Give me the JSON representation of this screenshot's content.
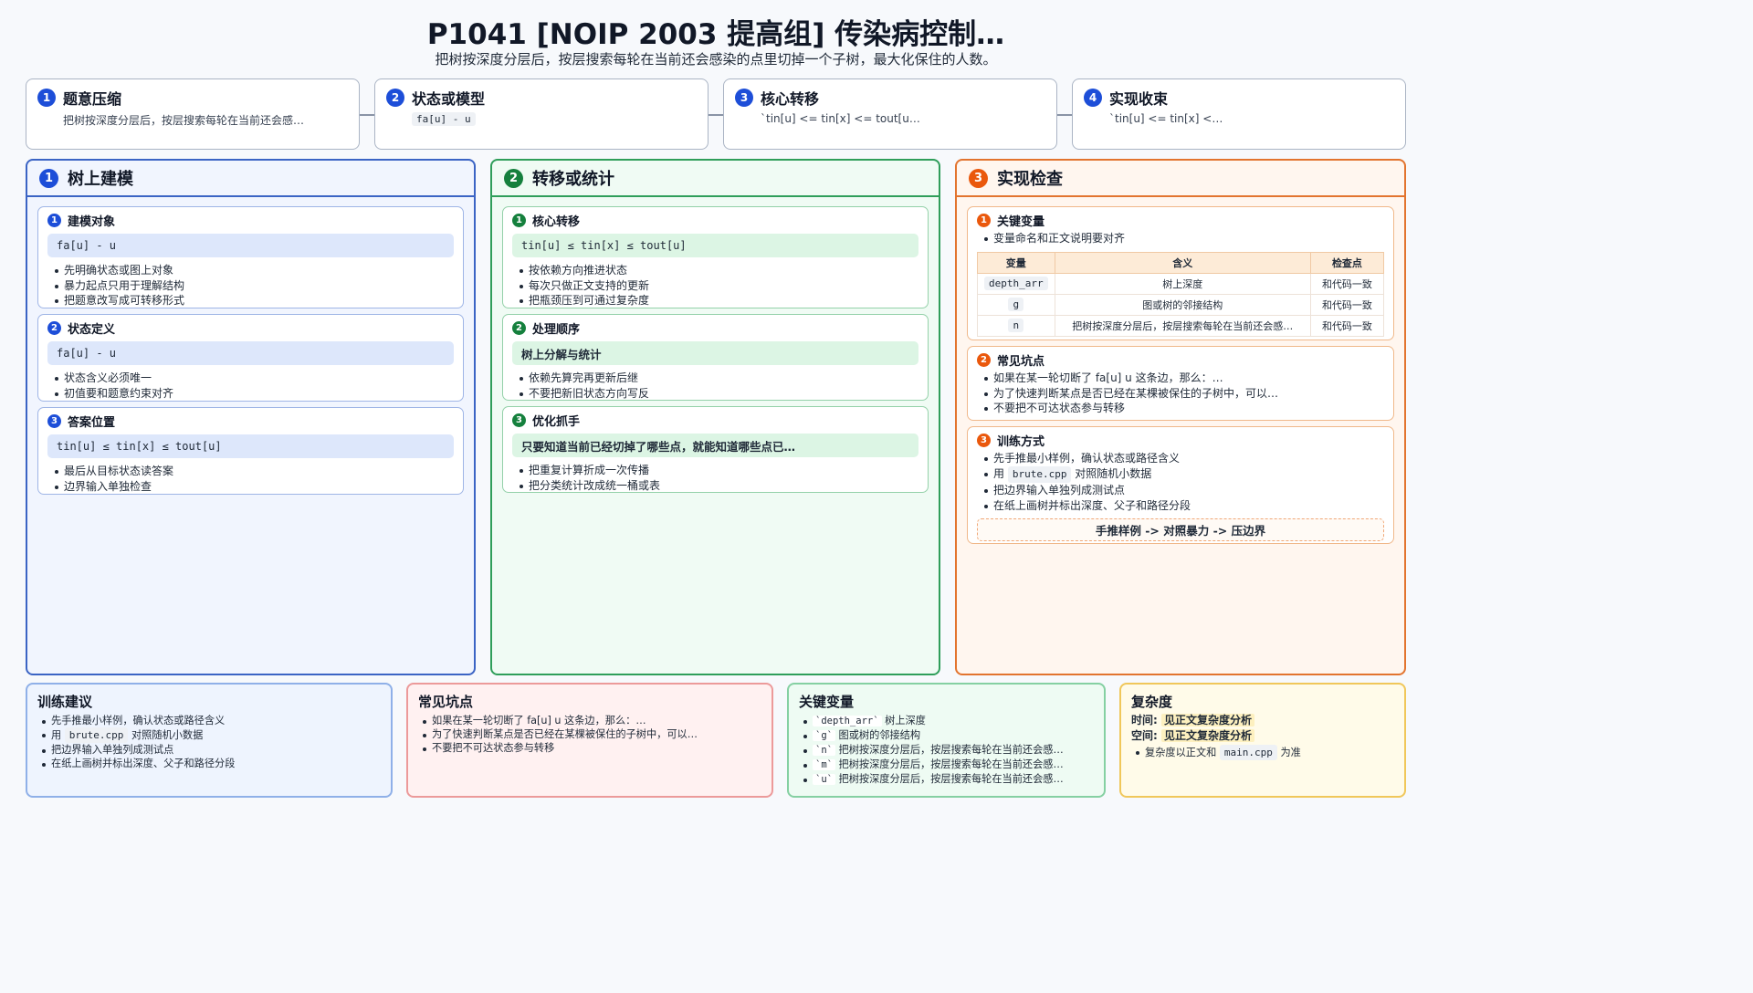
{
  "header": {
    "title": "P1041 [NOIP 2003 提高组] 传染病控制…",
    "subtitle": "把树按深度分层后，按层搜索每轮在当前还会感染的点里切掉一个子树，最大化保住的人数。"
  },
  "steps": [
    {
      "num": "1",
      "title": "题意压缩",
      "desc": "把树按深度分层后，按层搜索每轮在当前还会感…"
    },
    {
      "num": "2",
      "title": "状态或模型",
      "desc": "fa[u] - u"
    },
    {
      "num": "3",
      "title": "核心转移",
      "desc": "`tin[u] <= tin[x] <= tout[u…"
    },
    {
      "num": "4",
      "title": "实现收束",
      "desc": "`tin[u] <= tin[x] <…"
    }
  ],
  "panels": {
    "left": {
      "num": "1",
      "title": "树上建模",
      "cards": [
        {
          "num": "1",
          "title": "建模对象",
          "code": "fa[u] - u",
          "bullets": [
            "先明确状态或图上对象",
            "暴力起点只用于理解结构",
            "把题意改写成可转移形式"
          ]
        },
        {
          "num": "2",
          "title": "状态定义",
          "code": "fa[u] - u",
          "bullets": [
            "状态含义必须唯一",
            "初值要和题意约束对齐"
          ]
        },
        {
          "num": "3",
          "title": "答案位置",
          "code": "tin[u] ≤ tin[x] ≤ tout[u]",
          "bullets": [
            "最后从目标状态读答案",
            "边界输入单独检查"
          ]
        }
      ]
    },
    "middle": {
      "num": "2",
      "title": "转移或统计",
      "cards": [
        {
          "num": "1",
          "title": "核心转移",
          "code": "tin[u] ≤ tin[x] ≤ tout[u]",
          "bullets": [
            "按依赖方向推进状态",
            "每次只做正文支持的更新",
            "把瓶颈压到可通过复杂度"
          ]
        },
        {
          "num": "2",
          "title": "处理顺序",
          "code": "树上分解与统计",
          "bullets": [
            "依赖先算完再更新后继",
            "不要把新旧状态方向写反"
          ]
        },
        {
          "num": "3",
          "title": "优化抓手",
          "code": "只要知道当前已经切掉了哪些点，就能知道哪些点已…",
          "bullets": [
            "把重复计算折成一次传播",
            "把分类统计改成统一桶或表"
          ]
        }
      ]
    },
    "right": {
      "num": "3",
      "title": "实现检查",
      "vars_card": {
        "num": "1",
        "title": "关键变量",
        "bullet": "变量命名和正文说明要对齐",
        "headers": [
          "变量",
          "含义",
          "检查点"
        ],
        "rows": [
          [
            "depth_arr",
            "树上深度",
            "和代码一致"
          ],
          [
            "g",
            "图或树的邻接结构",
            "和代码一致"
          ],
          [
            "n",
            "把树按深度分层后，按层搜索每轮在当前还会感…",
            "和代码一致"
          ]
        ]
      },
      "pitfalls_card": {
        "num": "2",
        "title": "常见坑点",
        "bullets": [
          "如果在某一轮切断了 fa[u] u 这条边，那么：…",
          "为了快速判断某点是否已经在某棵被保住的子树中，可以…",
          "不要把不可达状态参与转移"
        ]
      },
      "train_card": {
        "num": "3",
        "title": "训练方式",
        "b1": "先手推最小样例，确认状态或路径含义",
        "b2_pre": "用",
        "b2_code": "brute.cpp",
        "b2_post": "对照随机小数据",
        "b3": "把边界输入单独列成测试点",
        "b4": "在纸上画树并标出深度、父子和路径分段",
        "flow": "手推样例 -> 对照暴力 -> 压边界"
      }
    }
  },
  "bottom": {
    "training": {
      "title": "训练建议",
      "b1": "先手推最小样例，确认状态或路径含义",
      "b2_pre": "用",
      "b2_code": "brute.cpp",
      "b2_post": "对照随机小数据",
      "b3": "把边界输入单独列成测试点",
      "b4": "在纸上画树并标出深度、父子和路径分段"
    },
    "pitfalls": {
      "title": "常见坑点",
      "bullets": [
        "如果在某一轮切断了 fa[u] u 这条边，那么：…",
        "为了快速判断某点是否已经在某棵被保住的子树中，可以…",
        "不要把不可达状态参与转移"
      ]
    },
    "variables": {
      "title": "关键变量",
      "items": [
        {
          "name": "`depth_arr`",
          "desc": "树上深度"
        },
        {
          "name": "`g`",
          "desc": "图或树的邻接结构"
        },
        {
          "name": "`n`",
          "desc": "把树按深度分层后，按层搜索每轮在当前还会感…"
        },
        {
          "name": "`m`",
          "desc": "把树按深度分层后，按层搜索每轮在当前还会感…"
        },
        {
          "name": "`u`",
          "desc": "把树按深度分层后，按层搜索每轮在当前还会感…"
        }
      ]
    },
    "complexity": {
      "title": "复杂度",
      "time_label": "时间:",
      "time_value": "见正文复杂度分析",
      "space_label": "空间:",
      "space_value": "见正文复杂度分析",
      "note_pre": "复杂度以正文和",
      "note_code": "main.cpp",
      "note_post": "为准"
    }
  }
}
